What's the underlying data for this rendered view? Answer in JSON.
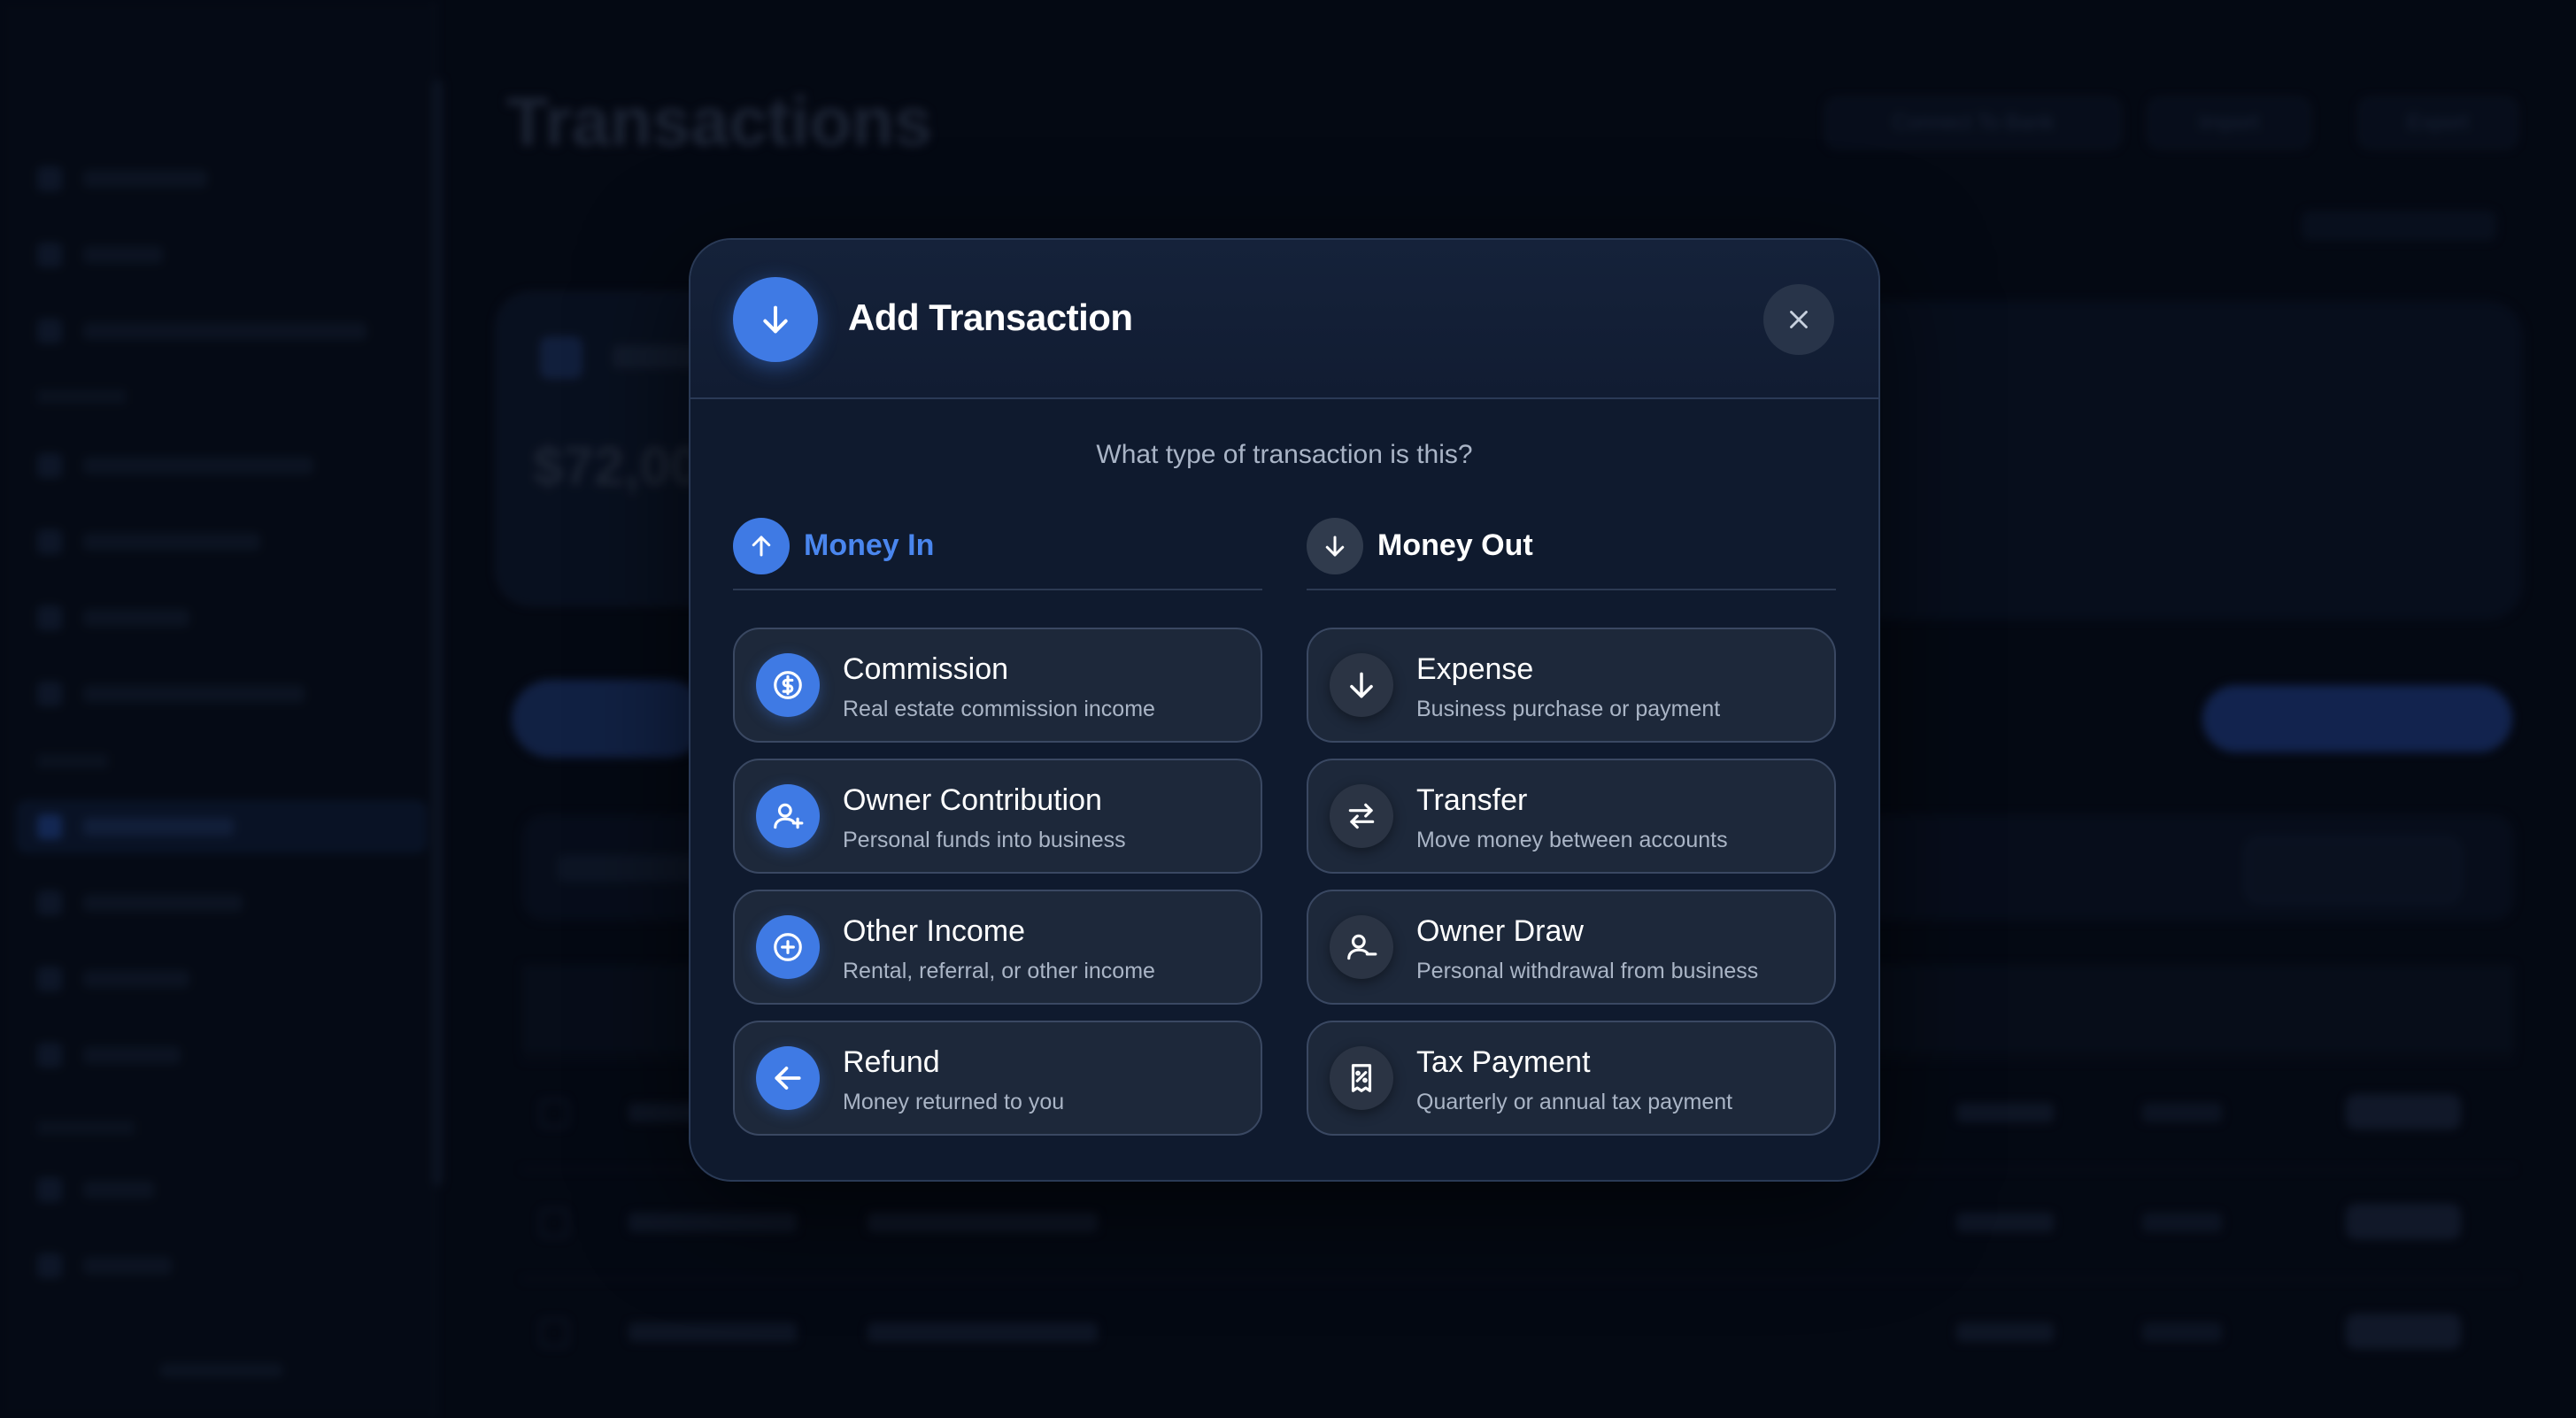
{
  "background": {
    "page_title": "Transactions",
    "balance_value": "$72,00",
    "header_buttons": [
      "Connect To Bank",
      "Import",
      "Export"
    ]
  },
  "modal": {
    "title": "Add Transaction",
    "header_icon": "arrow-down-icon",
    "close_icon": "close-icon",
    "prompt": "What type of transaction is this?",
    "money_in": {
      "label": "Money In",
      "icon": "arrow-up-icon",
      "accent": "#4a86ee",
      "options": [
        {
          "title": "Commission",
          "subtitle": "Real estate commission income",
          "icon": "dollar-circle-icon"
        },
        {
          "title": "Owner Contribution",
          "subtitle": "Personal funds into business",
          "icon": "user-plus-icon"
        },
        {
          "title": "Other Income",
          "subtitle": "Rental, referral, or other income",
          "icon": "plus-circle-icon"
        },
        {
          "title": "Refund",
          "subtitle": "Money returned to you",
          "icon": "arrow-left-icon"
        }
      ]
    },
    "money_out": {
      "label": "Money Out",
      "icon": "arrow-down-icon",
      "options": [
        {
          "title": "Expense",
          "subtitle": "Business purchase or payment",
          "icon": "arrow-down-icon"
        },
        {
          "title": "Transfer",
          "subtitle": "Move money between accounts",
          "icon": "transfer-arrows-icon"
        },
        {
          "title": "Owner Draw",
          "subtitle": "Personal withdrawal from business",
          "icon": "user-minus-icon"
        },
        {
          "title": "Tax Payment",
          "subtitle": "Quarterly or annual tax payment",
          "icon": "receipt-percent-icon"
        }
      ]
    }
  },
  "colors": {
    "accent_blue": "#3f7ae4",
    "modal_bg": "#0f1a2e",
    "option_bg": "#1d283a"
  }
}
